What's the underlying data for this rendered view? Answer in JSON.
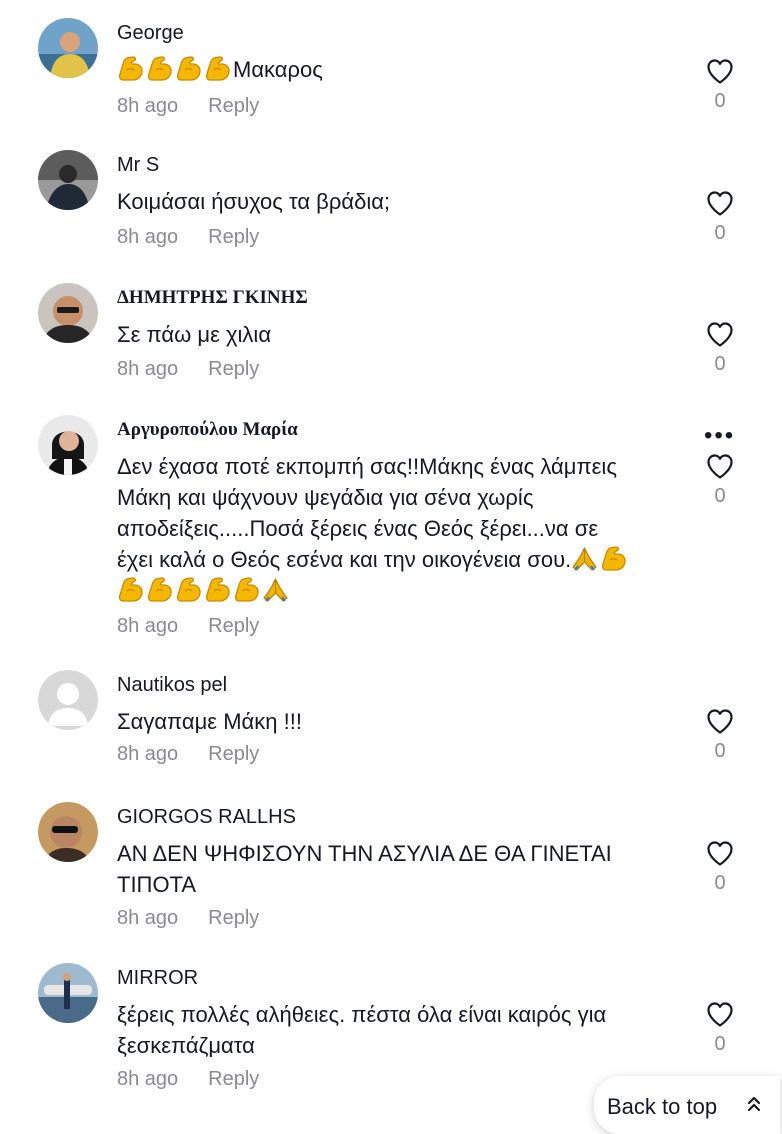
{
  "comments": [
    {
      "username": "George",
      "text": "Μακαρος",
      "prefix_emoji": [
        "flexed-biceps",
        "flexed-biceps",
        "flexed-biceps",
        "flexed-biceps"
      ],
      "time": "8h ago",
      "reply": "Reply",
      "likes": "0"
    },
    {
      "username": "Mr S",
      "text": "Κοιμάσαι ήσυχος τα βράδια;",
      "time": "8h ago",
      "reply": "Reply",
      "likes": "0"
    },
    {
      "username": "ΔΗΜΗΤΡΗΣ ΓΚΙΝΗΣ",
      "text": "Σε πάω με χιλια",
      "time": "8h ago",
      "reply": "Reply",
      "likes": "0"
    },
    {
      "username": "Αργυροπούλου Μαρία",
      "text_line1": "Δεν έχασα ποτέ εκπομπή σας!!Μάκης ένας λάμπεις",
      "text_line2": "Μάκη και ψάχνουν ψεγάδια για σένα χωρίς",
      "text_line3": "αποδείξεις.....Ποσά ξέρεις ένας Θεός ξέρει...να σε",
      "text_line4": "έχει καλά ο Θεός εσένα και την οικογένεια σου.",
      "more_icon": "•••",
      "time": "8h ago",
      "reply": "Reply",
      "likes": "0"
    },
    {
      "username": "Nautikos pel",
      "text": "Σαγαπαμε Μάκη !!!",
      "time": "8h ago",
      "reply": "Reply",
      "likes": "0"
    },
    {
      "username": "GIORGOS RALLHS",
      "text": "ΑΝ ΔΕΝ ΨΗΦΙΣΟΥΝ ΤΗΝ ΑΣΥΛΙΑ ΔΕ ΘΑ ΓΙΝΕΤΑΙ ΤΙΠΟΤΑ",
      "time": "8h ago",
      "reply": "Reply",
      "likes": "0"
    },
    {
      "username": "MIRROR",
      "text": "ξέρεις πολλές αλήθειες. πέστα όλα είναι καιρός για ξεσκεπάζματα",
      "time": "8h ago",
      "reply": "Reply",
      "likes": "0"
    }
  ],
  "back_to_top": {
    "label": "Back to top",
    "icon": "chevrons-up-icon"
  },
  "colors": {
    "text": "#161823",
    "meta": "#8a8b91",
    "emoji": "#f5b700",
    "emoji_outline": "#c98a00",
    "prayer": "#f2b300"
  }
}
